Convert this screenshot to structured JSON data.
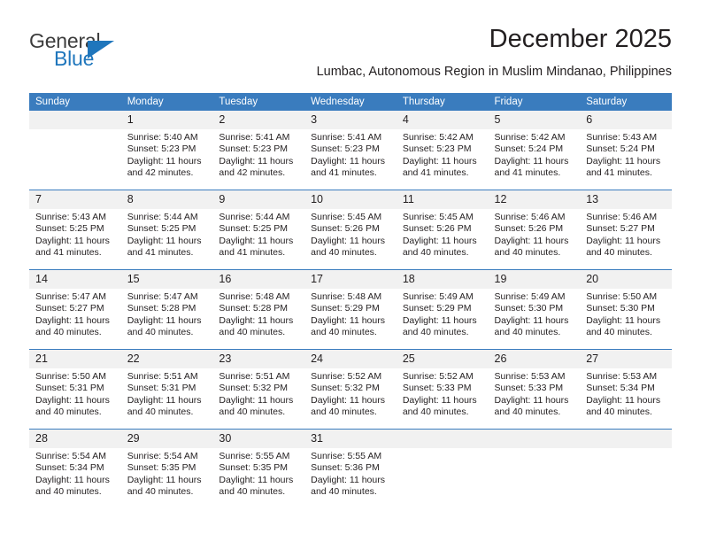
{
  "logo": {
    "primary_text": "General",
    "secondary_text": "Blue",
    "primary_color": "#3c3c3c",
    "secondary_color": "#1f76bc"
  },
  "header": {
    "title": "December 2025",
    "subtitle": "Lumbac, Autonomous Region in Muslim Mindanao, Philippines"
  },
  "theme": {
    "header_bg": "#3a7cbe",
    "header_text": "#ffffff",
    "daynum_bg": "#f1f1f1",
    "text": "#231f20"
  },
  "calendar": {
    "weekday_headers": [
      "Sunday",
      "Monday",
      "Tuesday",
      "Wednesday",
      "Thursday",
      "Friday",
      "Saturday"
    ],
    "weeks": [
      [
        {
          "day": "",
          "sunrise": "",
          "sunset": "",
          "daylight_line1": "",
          "daylight_line2": ""
        },
        {
          "day": "1",
          "sunrise": "Sunrise: 5:40 AM",
          "sunset": "Sunset: 5:23 PM",
          "daylight_line1": "Daylight: 11 hours",
          "daylight_line2": "and 42 minutes."
        },
        {
          "day": "2",
          "sunrise": "Sunrise: 5:41 AM",
          "sunset": "Sunset: 5:23 PM",
          "daylight_line1": "Daylight: 11 hours",
          "daylight_line2": "and 42 minutes."
        },
        {
          "day": "3",
          "sunrise": "Sunrise: 5:41 AM",
          "sunset": "Sunset: 5:23 PM",
          "daylight_line1": "Daylight: 11 hours",
          "daylight_line2": "and 41 minutes."
        },
        {
          "day": "4",
          "sunrise": "Sunrise: 5:42 AM",
          "sunset": "Sunset: 5:23 PM",
          "daylight_line1": "Daylight: 11 hours",
          "daylight_line2": "and 41 minutes."
        },
        {
          "day": "5",
          "sunrise": "Sunrise: 5:42 AM",
          "sunset": "Sunset: 5:24 PM",
          "daylight_line1": "Daylight: 11 hours",
          "daylight_line2": "and 41 minutes."
        },
        {
          "day": "6",
          "sunrise": "Sunrise: 5:43 AM",
          "sunset": "Sunset: 5:24 PM",
          "daylight_line1": "Daylight: 11 hours",
          "daylight_line2": "and 41 minutes."
        }
      ],
      [
        {
          "day": "7",
          "sunrise": "Sunrise: 5:43 AM",
          "sunset": "Sunset: 5:25 PM",
          "daylight_line1": "Daylight: 11 hours",
          "daylight_line2": "and 41 minutes."
        },
        {
          "day": "8",
          "sunrise": "Sunrise: 5:44 AM",
          "sunset": "Sunset: 5:25 PM",
          "daylight_line1": "Daylight: 11 hours",
          "daylight_line2": "and 41 minutes."
        },
        {
          "day": "9",
          "sunrise": "Sunrise: 5:44 AM",
          "sunset": "Sunset: 5:25 PM",
          "daylight_line1": "Daylight: 11 hours",
          "daylight_line2": "and 41 minutes."
        },
        {
          "day": "10",
          "sunrise": "Sunrise: 5:45 AM",
          "sunset": "Sunset: 5:26 PM",
          "daylight_line1": "Daylight: 11 hours",
          "daylight_line2": "and 40 minutes."
        },
        {
          "day": "11",
          "sunrise": "Sunrise: 5:45 AM",
          "sunset": "Sunset: 5:26 PM",
          "daylight_line1": "Daylight: 11 hours",
          "daylight_line2": "and 40 minutes."
        },
        {
          "day": "12",
          "sunrise": "Sunrise: 5:46 AM",
          "sunset": "Sunset: 5:26 PM",
          "daylight_line1": "Daylight: 11 hours",
          "daylight_line2": "and 40 minutes."
        },
        {
          "day": "13",
          "sunrise": "Sunrise: 5:46 AM",
          "sunset": "Sunset: 5:27 PM",
          "daylight_line1": "Daylight: 11 hours",
          "daylight_line2": "and 40 minutes."
        }
      ],
      [
        {
          "day": "14",
          "sunrise": "Sunrise: 5:47 AM",
          "sunset": "Sunset: 5:27 PM",
          "daylight_line1": "Daylight: 11 hours",
          "daylight_line2": "and 40 minutes."
        },
        {
          "day": "15",
          "sunrise": "Sunrise: 5:47 AM",
          "sunset": "Sunset: 5:28 PM",
          "daylight_line1": "Daylight: 11 hours",
          "daylight_line2": "and 40 minutes."
        },
        {
          "day": "16",
          "sunrise": "Sunrise: 5:48 AM",
          "sunset": "Sunset: 5:28 PM",
          "daylight_line1": "Daylight: 11 hours",
          "daylight_line2": "and 40 minutes."
        },
        {
          "day": "17",
          "sunrise": "Sunrise: 5:48 AM",
          "sunset": "Sunset: 5:29 PM",
          "daylight_line1": "Daylight: 11 hours",
          "daylight_line2": "and 40 minutes."
        },
        {
          "day": "18",
          "sunrise": "Sunrise: 5:49 AM",
          "sunset": "Sunset: 5:29 PM",
          "daylight_line1": "Daylight: 11 hours",
          "daylight_line2": "and 40 minutes."
        },
        {
          "day": "19",
          "sunrise": "Sunrise: 5:49 AM",
          "sunset": "Sunset: 5:30 PM",
          "daylight_line1": "Daylight: 11 hours",
          "daylight_line2": "and 40 minutes."
        },
        {
          "day": "20",
          "sunrise": "Sunrise: 5:50 AM",
          "sunset": "Sunset: 5:30 PM",
          "daylight_line1": "Daylight: 11 hours",
          "daylight_line2": "and 40 minutes."
        }
      ],
      [
        {
          "day": "21",
          "sunrise": "Sunrise: 5:50 AM",
          "sunset": "Sunset: 5:31 PM",
          "daylight_line1": "Daylight: 11 hours",
          "daylight_line2": "and 40 minutes."
        },
        {
          "day": "22",
          "sunrise": "Sunrise: 5:51 AM",
          "sunset": "Sunset: 5:31 PM",
          "daylight_line1": "Daylight: 11 hours",
          "daylight_line2": "and 40 minutes."
        },
        {
          "day": "23",
          "sunrise": "Sunrise: 5:51 AM",
          "sunset": "Sunset: 5:32 PM",
          "daylight_line1": "Daylight: 11 hours",
          "daylight_line2": "and 40 minutes."
        },
        {
          "day": "24",
          "sunrise": "Sunrise: 5:52 AM",
          "sunset": "Sunset: 5:32 PM",
          "daylight_line1": "Daylight: 11 hours",
          "daylight_line2": "and 40 minutes."
        },
        {
          "day": "25",
          "sunrise": "Sunrise: 5:52 AM",
          "sunset": "Sunset: 5:33 PM",
          "daylight_line1": "Daylight: 11 hours",
          "daylight_line2": "and 40 minutes."
        },
        {
          "day": "26",
          "sunrise": "Sunrise: 5:53 AM",
          "sunset": "Sunset: 5:33 PM",
          "daylight_line1": "Daylight: 11 hours",
          "daylight_line2": "and 40 minutes."
        },
        {
          "day": "27",
          "sunrise": "Sunrise: 5:53 AM",
          "sunset": "Sunset: 5:34 PM",
          "daylight_line1": "Daylight: 11 hours",
          "daylight_line2": "and 40 minutes."
        }
      ],
      [
        {
          "day": "28",
          "sunrise": "Sunrise: 5:54 AM",
          "sunset": "Sunset: 5:34 PM",
          "daylight_line1": "Daylight: 11 hours",
          "daylight_line2": "and 40 minutes."
        },
        {
          "day": "29",
          "sunrise": "Sunrise: 5:54 AM",
          "sunset": "Sunset: 5:35 PM",
          "daylight_line1": "Daylight: 11 hours",
          "daylight_line2": "and 40 minutes."
        },
        {
          "day": "30",
          "sunrise": "Sunrise: 5:55 AM",
          "sunset": "Sunset: 5:35 PM",
          "daylight_line1": "Daylight: 11 hours",
          "daylight_line2": "and 40 minutes."
        },
        {
          "day": "31",
          "sunrise": "Sunrise: 5:55 AM",
          "sunset": "Sunset: 5:36 PM",
          "daylight_line1": "Daylight: 11 hours",
          "daylight_line2": "and 40 minutes."
        },
        {
          "day": "",
          "sunrise": "",
          "sunset": "",
          "daylight_line1": "",
          "daylight_line2": ""
        },
        {
          "day": "",
          "sunrise": "",
          "sunset": "",
          "daylight_line1": "",
          "daylight_line2": ""
        },
        {
          "day": "",
          "sunrise": "",
          "sunset": "",
          "daylight_line1": "",
          "daylight_line2": ""
        }
      ]
    ]
  }
}
